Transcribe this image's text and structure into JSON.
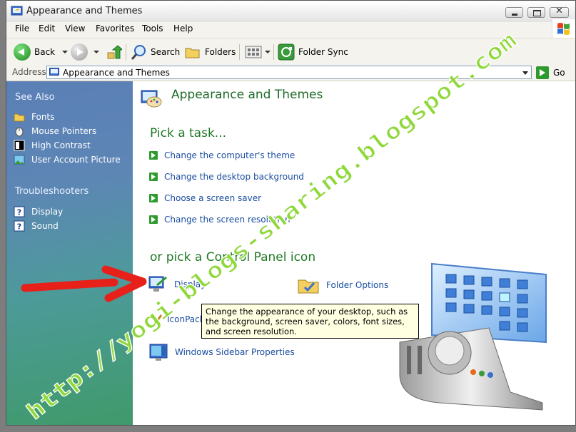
{
  "window": {
    "title": "Appearance and Themes"
  },
  "menu": [
    "File",
    "Edit",
    "View",
    "Favorites",
    "Tools",
    "Help"
  ],
  "toolbar": {
    "back": "Back",
    "search": "Search",
    "folders": "Folders",
    "folder_sync": "Folder Sync"
  },
  "address": {
    "label": "Address",
    "value": "Appearance and Themes",
    "go": "Go"
  },
  "sidebar": {
    "see_also_title": "See Also",
    "see_also": [
      {
        "label": "Fonts",
        "icon": "folder-icon"
      },
      {
        "label": "Mouse Pointers",
        "icon": "mouse-icon"
      },
      {
        "label": "High Contrast",
        "icon": "contrast-icon"
      },
      {
        "label": "User Account Picture",
        "icon": "picture-icon"
      }
    ],
    "troubleshooters_title": "Troubleshooters",
    "troubleshooters": [
      {
        "label": "Display",
        "icon": "help-icon"
      },
      {
        "label": "Sound",
        "icon": "help-icon"
      }
    ]
  },
  "main": {
    "title": "Appearance and Themes",
    "pick_task": "Pick a task...",
    "tasks": [
      "Change the computer's theme",
      "Change the desktop background",
      "Choose a screen saver",
      "Change the screen resolution"
    ],
    "pick_icon": "or pick a Control Panel icon",
    "icons": [
      {
        "label": "Display",
        "icon": "display-icon"
      },
      {
        "label": "Folder Options",
        "icon": "folder-options-icon"
      },
      {
        "label": "IconPackager",
        "icon": "iconpackager-icon"
      },
      {
        "label": "Windows Sidebar Properties",
        "icon": "sidebar-icon"
      }
    ]
  },
  "tooltip": "Change the appearance of your desktop, such as the background, screen saver, colors, font sizes, and screen resolution.",
  "watermark": "http://yogi-blogs-sharing.blogspot.com",
  "colors": {
    "sidebar_top": "#5a7fb6",
    "sidebar_bottom": "#3f9a6a",
    "link": "#1a4ea0",
    "heading": "#1e7a24",
    "arrow": "#e8201a",
    "watermark": "#8fd83a"
  }
}
